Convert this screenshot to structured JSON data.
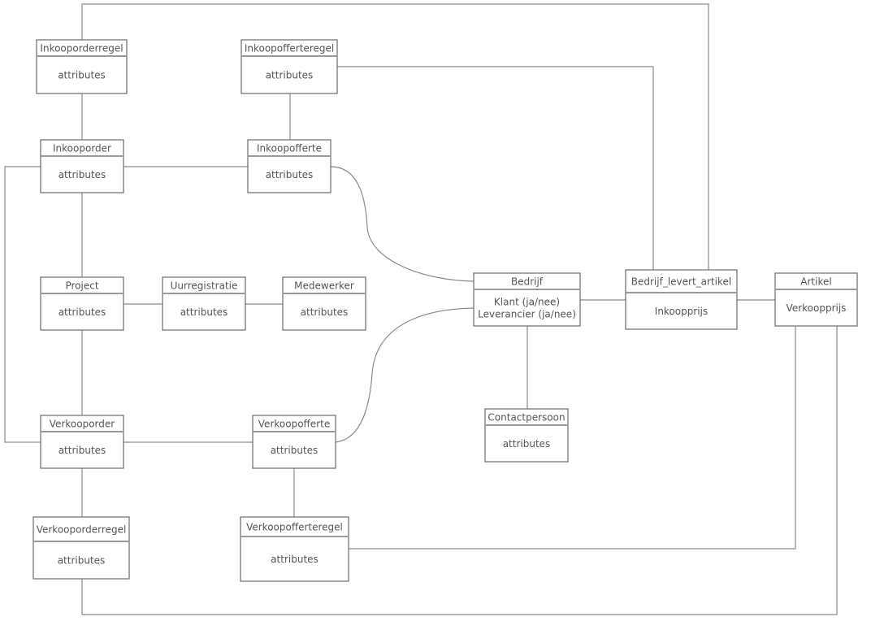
{
  "diagram": {
    "type": "entity-relationship",
    "entities": [
      {
        "id": "inkooporderregel",
        "title": "Inkooporderregel",
        "attributes": [
          "attributes"
        ]
      },
      {
        "id": "inkoopofferteregel",
        "title": "Inkoopofferteregel",
        "attributes": [
          "attributes"
        ]
      },
      {
        "id": "inkooporder",
        "title": "Inkooporder",
        "attributes": [
          "attributes"
        ]
      },
      {
        "id": "inkoopofferte",
        "title": "Inkoopofferte",
        "attributes": [
          "attributes"
        ]
      },
      {
        "id": "project",
        "title": "Project",
        "attributes": [
          "attributes"
        ]
      },
      {
        "id": "uurregistratie",
        "title": "Uurregistratie",
        "attributes": [
          "attributes"
        ]
      },
      {
        "id": "medewerker",
        "title": "Medewerker",
        "attributes": [
          "attributes"
        ]
      },
      {
        "id": "bedrijf",
        "title": "Bedrijf",
        "attributes": [
          "Klant (ja/nee)",
          "Leverancier (ja/nee)"
        ]
      },
      {
        "id": "bedrijf_levert_artikel",
        "title": "Bedrijf_levert_artikel",
        "attributes": [
          "Inkoopprijs"
        ]
      },
      {
        "id": "artikel",
        "title": "Artikel",
        "attributes": [
          "Verkoopprijs"
        ]
      },
      {
        "id": "contactpersoon",
        "title": "Contactpersoon",
        "attributes": [
          "attributes"
        ]
      },
      {
        "id": "verkooporder",
        "title": "Verkooporder",
        "attributes": [
          "attributes"
        ]
      },
      {
        "id": "verkoopofferte",
        "title": "Verkoopofferte",
        "attributes": [
          "attributes"
        ]
      },
      {
        "id": "verkooporderregel",
        "title": "Verkooporderregel",
        "attributes": [
          "attributes"
        ]
      },
      {
        "id": "verkoopofferteregel",
        "title": "Verkoopofferteregel",
        "attributes": [
          "attributes"
        ]
      }
    ],
    "relationships": [
      {
        "from": "inkooporderregel",
        "to": "inkooporder"
      },
      {
        "from": "inkooporderregel",
        "to": "bedrijf_levert_artikel"
      },
      {
        "from": "inkoopofferteregel",
        "to": "inkoopofferte"
      },
      {
        "from": "inkoopofferteregel",
        "to": "bedrijf_levert_artikel"
      },
      {
        "from": "inkooporder",
        "to": "inkoopofferte"
      },
      {
        "from": "inkooporder",
        "to": "project"
      },
      {
        "from": "inkooporder",
        "to": "verkooporder"
      },
      {
        "from": "inkoopofferte",
        "to": "bedrijf"
      },
      {
        "from": "project",
        "to": "uurregistratie"
      },
      {
        "from": "uurregistratie",
        "to": "medewerker"
      },
      {
        "from": "project",
        "to": "verkooporder"
      },
      {
        "from": "verkooporder",
        "to": "verkoopofferte"
      },
      {
        "from": "verkooporder",
        "to": "verkooporderregel"
      },
      {
        "from": "verkoopofferte",
        "to": "bedrijf"
      },
      {
        "from": "verkoopofferte",
        "to": "verkoopofferteregel"
      },
      {
        "from": "bedrijf",
        "to": "bedrijf_levert_artikel"
      },
      {
        "from": "bedrijf",
        "to": "contactpersoon"
      },
      {
        "from": "bedrijf_levert_artikel",
        "to": "artikel"
      },
      {
        "from": "verkoopofferteregel",
        "to": "artikel"
      },
      {
        "from": "verkooporderregel",
        "to": "artikel"
      }
    ]
  }
}
